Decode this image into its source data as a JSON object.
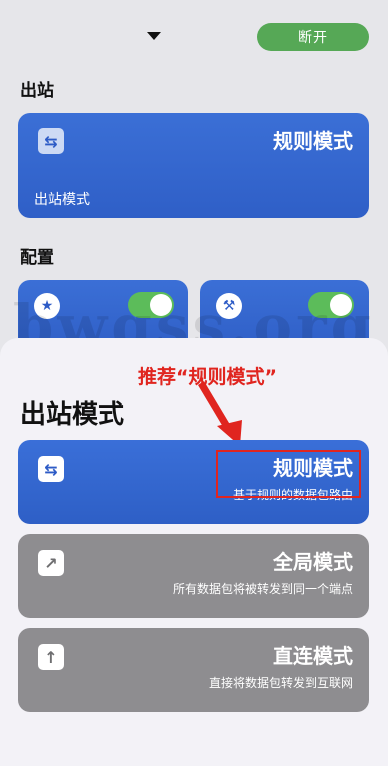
{
  "topbar": {
    "disconnect_label": "断开"
  },
  "sections": {
    "outbound_title": "出站",
    "config_title": "配置"
  },
  "bg_outbound_card": {
    "mode_value": "规则模式",
    "caption": "出站模式"
  },
  "watermark": {
    "text": "bwgss.org"
  },
  "annotation": {
    "text": "推荐“规则模式”"
  },
  "sheet": {
    "title": "出站模式",
    "options": [
      {
        "title": "规则模式",
        "subtitle": "基于规则的数据包路由",
        "icon": "swap-arrows-icon",
        "selected": true
      },
      {
        "title": "全局模式",
        "subtitle": "所有数据包将被转发到同一个端点",
        "icon": "arrow-up-right-icon",
        "selected": false
      },
      {
        "title": "直连模式",
        "subtitle": "直接将数据包转发到互联网",
        "icon": "arrow-up-icon",
        "selected": false
      }
    ]
  },
  "colors": {
    "accent_blue": "#2f5fc7",
    "toggle_green": "#5cbc5a",
    "button_green": "#56a856",
    "annotation_red": "#e0251f",
    "option_gray": "#8e8d90"
  }
}
